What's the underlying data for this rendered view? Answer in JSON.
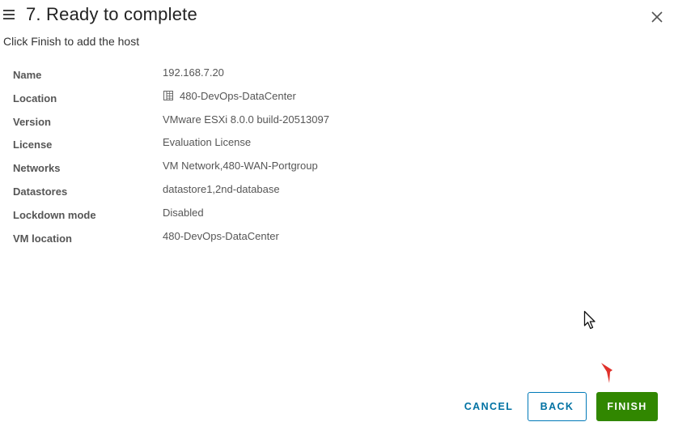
{
  "dialog": {
    "title": "7. Ready to complete",
    "subtitle": "Click Finish to add the host"
  },
  "properties": [
    {
      "label": "Name",
      "value": "192.168.7.20"
    },
    {
      "label": "Location",
      "value": "480-DevOps-DataCenter",
      "icon": "datacenter-icon"
    },
    {
      "label": "Version",
      "value": "VMware ESXi 8.0.0 build-20513097"
    },
    {
      "label": "License",
      "value": "Evaluation License"
    },
    {
      "label": "Networks",
      "value": "VM Network,480-WAN-Portgroup"
    },
    {
      "label": "Datastores",
      "value": "datastore1,2nd-database"
    },
    {
      "label": "Lockdown mode",
      "value": "Disabled"
    },
    {
      "label": "VM location",
      "value": "480-DevOps-DataCenter"
    }
  ],
  "buttons": {
    "cancel": "CANCEL",
    "back": "BACK",
    "finish": "FINISH"
  },
  "colors": {
    "primary_blue": "#0072a3",
    "finish_green": "#318700",
    "annotation_red": "#e0302a"
  }
}
